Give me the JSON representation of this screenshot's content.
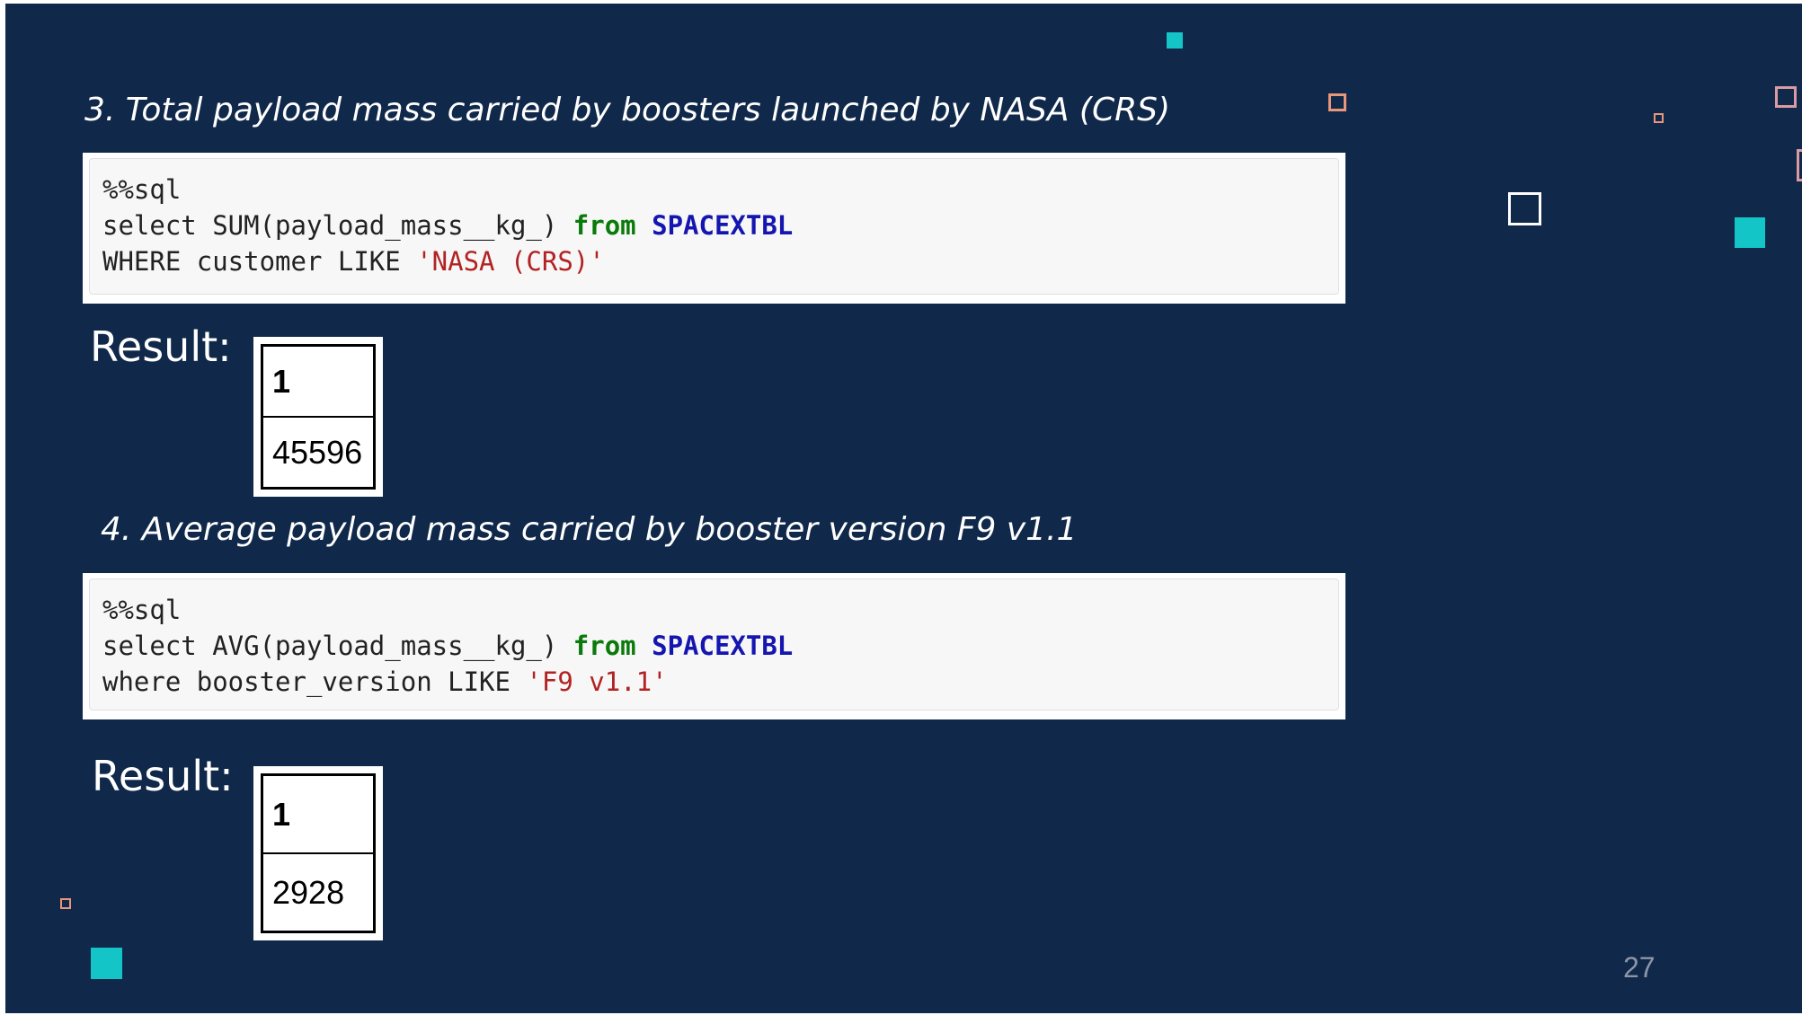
{
  "section3": {
    "heading": "3. Total payload mass carried by boosters launched by NASA (CRS)",
    "code": {
      "line1": "%%sql",
      "line2_pre": "select SUM(payload_mass__kg_) ",
      "line2_kw": "from",
      "line2_table": "SPACEXTBL",
      "line3_pre": "WHERE customer LIKE ",
      "line3_str": "'NASA (CRS)'"
    },
    "result_label": "Result:",
    "result_header": "1",
    "result_value": "45596"
  },
  "section4": {
    "heading": "4. Average payload mass carried by booster version F9 v1.1",
    "code": {
      "line1": "%%sql",
      "line2_pre": "select AVG(payload_mass__kg_) ",
      "line2_kw": "from",
      "line2_table": "SPACEXTBL",
      "line3_pre": "where booster_version LIKE ",
      "line3_str": "'F9 v1.1'"
    },
    "result_label": "Result:",
    "result_header": "1",
    "result_value": "2928"
  },
  "page_number": "27",
  "colors": {
    "background": "#10284a",
    "accent_teal": "#13c5c7",
    "accent_salmon": "#e8977a",
    "sql_keyword": "#0a7a0a",
    "sql_table": "#1515b0",
    "sql_string": "#b22222"
  }
}
